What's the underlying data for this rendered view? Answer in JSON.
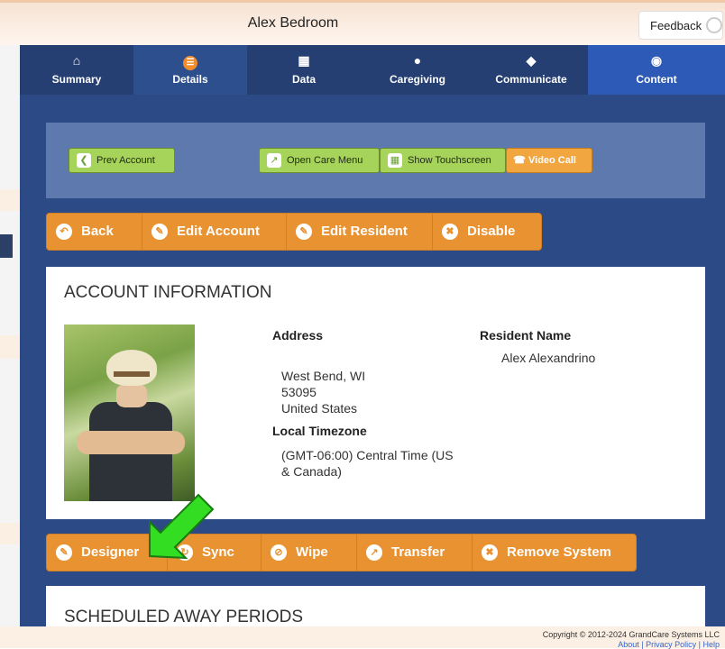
{
  "header": {
    "title": "Alex Bedroom",
    "feedback_label": "Feedback"
  },
  "tabs": [
    {
      "label": "Summary",
      "icon": "home-icon"
    },
    {
      "label": "Details",
      "icon": "list-icon"
    },
    {
      "label": "Data",
      "icon": "grid-icon"
    },
    {
      "label": "Caregiving",
      "icon": "person-icon"
    },
    {
      "label": "Communicate",
      "icon": "tag-icon"
    },
    {
      "label": "Content",
      "icon": "camera-icon"
    }
  ],
  "top_actions": {
    "prev_account": "Prev Account",
    "open_care_menu": "Open Care Menu",
    "show_touchscreen": "Show Touchscreen",
    "video_call": "Video Call"
  },
  "account_actions": {
    "back": "Back",
    "edit_account": "Edit Account",
    "edit_resident": "Edit Resident",
    "disable": "Disable"
  },
  "account_info": {
    "heading": "ACCOUNT INFORMATION",
    "address_label": "Address",
    "address_line1": "West Bend, WI",
    "address_line2": "53095",
    "address_line3": "United States",
    "timezone_label": "Local Timezone",
    "timezone_line1": "(GMT-06:00) Central Time (US",
    "timezone_line2": "& Canada)",
    "resident_label": "Resident Name",
    "resident_name": "Alex Alexandrino"
  },
  "system_actions": {
    "designer": "Designer",
    "sync": "Sync",
    "wipe": "Wipe",
    "transfer": "Transfer",
    "remove_system": "Remove System"
  },
  "away": {
    "heading": "SCHEDULED AWAY PERIODS"
  },
  "footer": {
    "copyright": "Copyright © 2012-2024 GrandCare Systems LLC",
    "links": "About | Privacy Policy | Help"
  },
  "colors": {
    "nav_bg": "#253f72",
    "page_bg": "#2b4a86",
    "accent_orange": "#e89231",
    "accent_green": "#a6d35a",
    "arrow_green": "#33dd22"
  }
}
